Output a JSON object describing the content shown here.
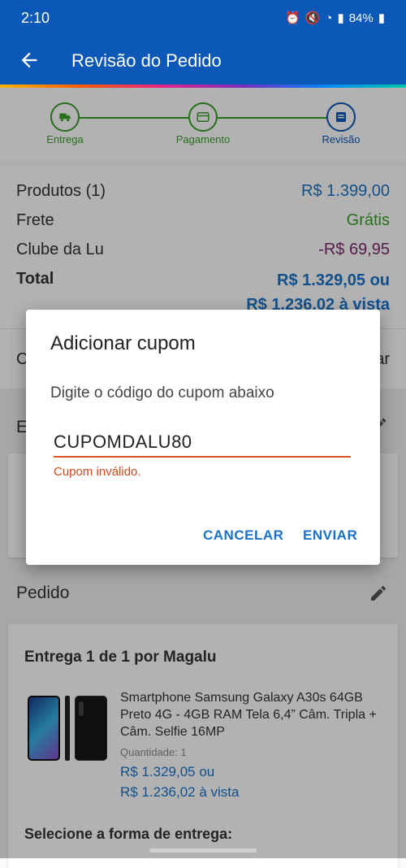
{
  "status_bar": {
    "time": "2:10",
    "battery": "84%"
  },
  "app_bar": {
    "title": "Revisão do Pedido"
  },
  "stepper": {
    "steps": [
      {
        "label": "Entrega"
      },
      {
        "label": "Pagamento"
      },
      {
        "label": "Revisão"
      }
    ]
  },
  "summary": {
    "produtos_label": "Produtos (1)",
    "produtos_value": "R$ 1.399,00",
    "frete_label": "Frete",
    "frete_value": "Grátis",
    "clube_label": "Clube da Lu",
    "clube_value": "-R$ 69,95",
    "total_label": "Total",
    "total_value_1": "R$ 1.329,05 ou",
    "total_value_2": "R$ 1.236,02 à vista"
  },
  "coupon_row": {
    "left_text": "C",
    "right_text": "ar"
  },
  "entrega_section": {
    "heading_partial": "E"
  },
  "pedido": {
    "heading": "Pedido",
    "delivery_title": "Entrega 1 de 1 por Magalu",
    "product_name": "Smartphone Samsung Galaxy A30s 64GB Preto 4G - 4GB RAM Tela 6,4” Câm. Tripla + Câm. Selfie 16MP",
    "quantity_label": "Quantidade:",
    "quantity_value": "1",
    "price_1": "R$ 1.329,05 ou",
    "price_2": "R$ 1.236,02 à vista",
    "delivery_select": "Selecione a forma de entrega:"
  },
  "dialog": {
    "title": "Adicionar cupom",
    "message": "Digite o código do cupom abaixo",
    "input_value": "CUPOMDALU80",
    "error": "Cupom inválido.",
    "cancel_label": "CANCELAR",
    "send_label": "ENVIAR"
  },
  "colors": {
    "primary": "#0B58B8",
    "success": "#3aa02c",
    "discount": "#7a2a6e",
    "link": "#1a73c9",
    "error": "#d34a1b"
  }
}
